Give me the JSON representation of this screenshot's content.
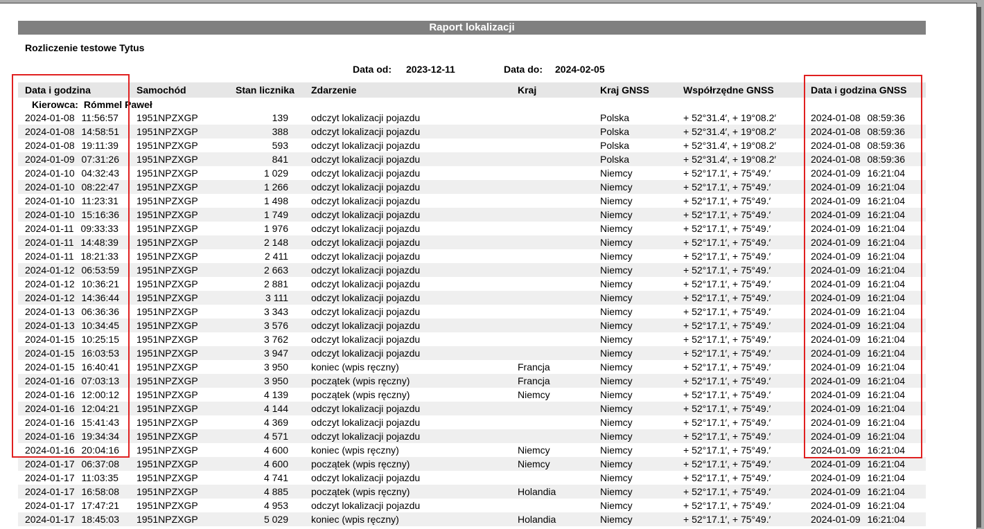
{
  "report": {
    "title": "Raport lokalizacji",
    "subtitle": "Rozliczenie testowe Tytus",
    "date_from_label": "Data od:",
    "date_from": "2023-12-11",
    "date_to_label": "Data do:",
    "date_to": "2024-02-05"
  },
  "columns": [
    "Data i godzina",
    "Samochód",
    "Stan licznika",
    "Zdarzenie",
    "Kraj",
    "Kraj GNSS",
    "Współrzędne GNSS",
    "Data i godzina GNSS"
  ],
  "driver": {
    "label": "Kierowca:",
    "name": "Rómmel Paweł"
  },
  "rows": [
    [
      "2024-01-08 11:56:57",
      "1951NPZXGP",
      "139",
      "odczyt lokalizacji pojazdu",
      "",
      "Polska",
      "+ 52°31.4′, + 19°08.2′",
      "2024-01-08 08:59:36"
    ],
    [
      "2024-01-08 14:58:51",
      "1951NPZXGP",
      "388",
      "odczyt lokalizacji pojazdu",
      "",
      "Polska",
      "+ 52°31.4′, + 19°08.2′",
      "2024-01-08 08:59:36"
    ],
    [
      "2024-01-08 19:11:39",
      "1951NPZXGP",
      "593",
      "odczyt lokalizacji pojazdu",
      "",
      "Polska",
      "+ 52°31.4′, + 19°08.2′",
      "2024-01-08 08:59:36"
    ],
    [
      "2024-01-09 07:31:26",
      "1951NPZXGP",
      "841",
      "odczyt lokalizacji pojazdu",
      "",
      "Polska",
      "+ 52°31.4′, + 19°08.2′",
      "2024-01-08 08:59:36"
    ],
    [
      "2024-01-10 04:32:43",
      "1951NPZXGP",
      "1 029",
      "odczyt lokalizacji pojazdu",
      "",
      "Niemcy",
      "+ 52°17.1′, + 75°49.′",
      "2024-01-09 16:21:04"
    ],
    [
      "2024-01-10 08:22:47",
      "1951NPZXGP",
      "1 266",
      "odczyt lokalizacji pojazdu",
      "",
      "Niemcy",
      "+ 52°17.1′, + 75°49.′",
      "2024-01-09 16:21:04"
    ],
    [
      "2024-01-10 11:23:31",
      "1951NPZXGP",
      "1 498",
      "odczyt lokalizacji pojazdu",
      "",
      "Niemcy",
      "+ 52°17.1′, + 75°49.′",
      "2024-01-09 16:21:04"
    ],
    [
      "2024-01-10 15:16:36",
      "1951NPZXGP",
      "1 749",
      "odczyt lokalizacji pojazdu",
      "",
      "Niemcy",
      "+ 52°17.1′, + 75°49.′",
      "2024-01-09 16:21:04"
    ],
    [
      "2024-01-11 09:33:33",
      "1951NPZXGP",
      "1 976",
      "odczyt lokalizacji pojazdu",
      "",
      "Niemcy",
      "+ 52°17.1′, + 75°49.′",
      "2024-01-09 16:21:04"
    ],
    [
      "2024-01-11 14:48:39",
      "1951NPZXGP",
      "2 148",
      "odczyt lokalizacji pojazdu",
      "",
      "Niemcy",
      "+ 52°17.1′, + 75°49.′",
      "2024-01-09 16:21:04"
    ],
    [
      "2024-01-11 18:21:33",
      "1951NPZXGP",
      "2 411",
      "odczyt lokalizacji pojazdu",
      "",
      "Niemcy",
      "+ 52°17.1′, + 75°49.′",
      "2024-01-09 16:21:04"
    ],
    [
      "2024-01-12 06:53:59",
      "1951NPZXGP",
      "2 663",
      "odczyt lokalizacji pojazdu",
      "",
      "Niemcy",
      "+ 52°17.1′, + 75°49.′",
      "2024-01-09 16:21:04"
    ],
    [
      "2024-01-12 10:36:21",
      "1951NPZXGP",
      "2 881",
      "odczyt lokalizacji pojazdu",
      "",
      "Niemcy",
      "+ 52°17.1′, + 75°49.′",
      "2024-01-09 16:21:04"
    ],
    [
      "2024-01-12 14:36:44",
      "1951NPZXGP",
      "3 111",
      "odczyt lokalizacji pojazdu",
      "",
      "Niemcy",
      "+ 52°17.1′, + 75°49.′",
      "2024-01-09 16:21:04"
    ],
    [
      "2024-01-13 06:36:36",
      "1951NPZXGP",
      "3 343",
      "odczyt lokalizacji pojazdu",
      "",
      "Niemcy",
      "+ 52°17.1′, + 75°49.′",
      "2024-01-09 16:21:04"
    ],
    [
      "2024-01-13 10:34:45",
      "1951NPZXGP",
      "3 576",
      "odczyt lokalizacji pojazdu",
      "",
      "Niemcy",
      "+ 52°17.1′, + 75°49.′",
      "2024-01-09 16:21:04"
    ],
    [
      "2024-01-15 10:25:15",
      "1951NPZXGP",
      "3 762",
      "odczyt lokalizacji pojazdu",
      "",
      "Niemcy",
      "+ 52°17.1′, + 75°49.′",
      "2024-01-09 16:21:04"
    ],
    [
      "2024-01-15 16:03:53",
      "1951NPZXGP",
      "3 947",
      "odczyt lokalizacji pojazdu",
      "",
      "Niemcy",
      "+ 52°17.1′, + 75°49.′",
      "2024-01-09 16:21:04"
    ],
    [
      "2024-01-15 16:40:41",
      "1951NPZXGP",
      "3 950",
      "koniec (wpis ręczny)",
      "Francja",
      "Niemcy",
      "+ 52°17.1′, + 75°49.′",
      "2024-01-09 16:21:04"
    ],
    [
      "2024-01-16 07:03:13",
      "1951NPZXGP",
      "3 950",
      "początek (wpis ręczny)",
      "Francja",
      "Niemcy",
      "+ 52°17.1′, + 75°49.′",
      "2024-01-09 16:21:04"
    ],
    [
      "2024-01-16 12:00:12",
      "1951NPZXGP",
      "4 139",
      "początek (wpis ręczny)",
      "Niemcy",
      "Niemcy",
      "+ 52°17.1′, + 75°49.′",
      "2024-01-09 16:21:04"
    ],
    [
      "2024-01-16 12:04:21",
      "1951NPZXGP",
      "4 144",
      "odczyt lokalizacji pojazdu",
      "",
      "Niemcy",
      "+ 52°17.1′, + 75°49.′",
      "2024-01-09 16:21:04"
    ],
    [
      "2024-01-16 15:41:43",
      "1951NPZXGP",
      "4 369",
      "odczyt lokalizacji pojazdu",
      "",
      "Niemcy",
      "+ 52°17.1′, + 75°49.′",
      "2024-01-09 16:21:04"
    ],
    [
      "2024-01-16 19:34:34",
      "1951NPZXGP",
      "4 571",
      "odczyt lokalizacji pojazdu",
      "",
      "Niemcy",
      "+ 52°17.1′, + 75°49.′",
      "2024-01-09 16:21:04"
    ],
    [
      "2024-01-16 20:04:16",
      "1951NPZXGP",
      "4 600",
      "koniec (wpis ręczny)",
      "Niemcy",
      "Niemcy",
      "+ 52°17.1′, + 75°49.′",
      "2024-01-09 16:21:04"
    ],
    [
      "2024-01-17 06:37:08",
      "1951NPZXGP",
      "4 600",
      "początek (wpis ręczny)",
      "Niemcy",
      "Niemcy",
      "+ 52°17.1′, + 75°49.′",
      "2024-01-09 16:21:04"
    ],
    [
      "2024-01-17 11:03:35",
      "1951NPZXGP",
      "4 741",
      "odczyt lokalizacji pojazdu",
      "",
      "Niemcy",
      "+ 52°17.1′, + 75°49.′",
      "2024-01-09 16:21:04"
    ],
    [
      "2024-01-17 16:58:08",
      "1951NPZXGP",
      "4 885",
      "początek (wpis ręczny)",
      "Holandia",
      "Niemcy",
      "+ 52°17.1′, + 75°49.′",
      "2024-01-09 16:21:04"
    ],
    [
      "2024-01-17 17:47:21",
      "1951NPZXGP",
      "4 953",
      "odczyt lokalizacji pojazdu",
      "",
      "Niemcy",
      "+ 52°17.1′, + 75°49.′",
      "2024-01-09 16:21:04"
    ],
    [
      "2024-01-17 18:45:03",
      "1951NPZXGP",
      "5 029",
      "koniec (wpis ręczny)",
      "Holandia",
      "Niemcy",
      "+ 52°17.1′, + 75°49.′",
      "2024-01-09 16:21:04"
    ]
  ]
}
